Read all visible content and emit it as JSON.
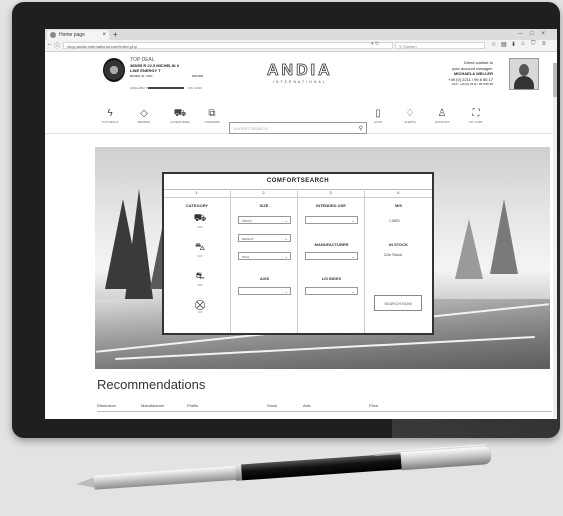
{
  "browser": {
    "tab_title": "Home page",
    "url": "shop.andia-international.com/index.php",
    "search_placeholder": "Suchen"
  },
  "deal": {
    "label": "TOP DEAL",
    "line1": "385/55 R 22.5 MICHELIN X",
    "line2": "LINE ENERGY T",
    "line3": "BASED IN / SAP",
    "line4": "DRIVER",
    "bar_left": "AVAILABILITY",
    "bar_right": "FIN. 03/20"
  },
  "logo": {
    "name": "ANDIA",
    "sub": "INTERNATIONAL"
  },
  "contact": {
    "line1": "Direct contact to",
    "line2": "your account manager:",
    "name": "MICHAELA WELLER",
    "phone": "+49 (0) 2211 / 99 8 86 17",
    "fax": "FAX: +49 (0) 2211 / 99 8 86 99"
  },
  "nav": {
    "left": [
      "TOP DEALS",
      "BRANDS",
      "CATEGORIES",
      "COMPARE"
    ],
    "right": [
      "LISTS",
      "ALERTS",
      "ACCOUNT",
      "MY CART"
    ]
  },
  "expert_search": {
    "placeholder": "EXPERT SEARCH"
  },
  "comfort": {
    "title": "COMFORTSEARCH",
    "nums": [
      "1.",
      "2.",
      "3.",
      "4."
    ],
    "category_head": "CATEGORY",
    "vehicles": [
      "LKW",
      "SUV",
      "AXF",
      "LKF"
    ],
    "size_head": "SIZE",
    "width": "WIDTH",
    "height": "HEIGHT",
    "inch": "INCH",
    "axis_head": "AXIS",
    "use_head": "INTENDED USE",
    "manufacturer_head": "MANUFACTURER",
    "ls_head": "L/S INDEX",
    "ms_head": "M/S",
    "ms_check": "M/S",
    "stock_head": "IN STOCK",
    "stock_check": "In Stock",
    "button": "SEARCH NOW"
  },
  "recommendations": {
    "title": "Recommendations",
    "columns": [
      "Dimension",
      "Manufacturer",
      "Profile",
      "Stock",
      "Axis",
      "Price"
    ]
  }
}
